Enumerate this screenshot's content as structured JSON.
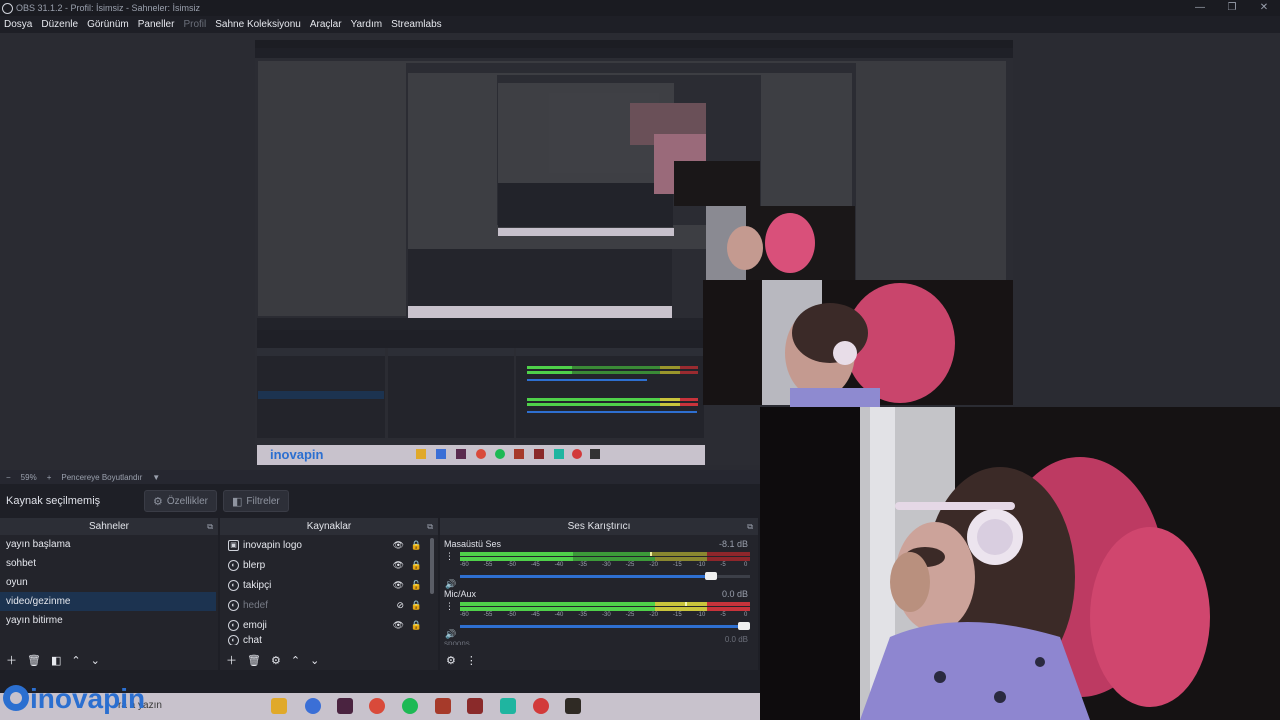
{
  "window": {
    "title": "OBS 31.1.2 - Profil: İsimsiz - Sahneler: İsimsiz",
    "min": "—",
    "max": "❐",
    "close": "✕"
  },
  "menu": {
    "items": [
      "Dosya",
      "Düzenle",
      "Görünüm",
      "Paneller",
      "Profil",
      "Sahne Koleksiyonu",
      "Araçlar",
      "Yardım",
      "Streamlabs"
    ]
  },
  "zoom": {
    "minus": "−",
    "value": "59%",
    "plus": "+",
    "fit": "Pencereye Boyutlandır",
    "caret": "▼"
  },
  "source_toolbar": {
    "status": "Kaynak seçilmemiş",
    "properties": "Özellikler",
    "filters": "Filtreler"
  },
  "scenes": {
    "title": "Sahneler",
    "items": [
      "yayın başlama",
      "sohbet",
      "oyun",
      "video/gezinme",
      "yayın bitirme"
    ],
    "selected": 3
  },
  "sources": {
    "title": "Kaynaklar",
    "items": [
      {
        "label": "inovapin logo",
        "icon": "image-icon"
      },
      {
        "label": "blerp",
        "icon": "browser-icon"
      },
      {
        "label": "takipçi",
        "icon": "browser-icon"
      },
      {
        "label": "hedef",
        "icon": "browser-icon"
      },
      {
        "label": "emoji",
        "icon": "browser-icon"
      },
      {
        "label": "chat",
        "icon": "browser-icon"
      }
    ]
  },
  "mixer": {
    "title": "Ses Karıştırıcı",
    "channels": [
      {
        "name": "Masaüstü Ses",
        "db": "-8.1 dB",
        "volume": 0.88
      },
      {
        "name": "Mic/Aux",
        "db": "0.0 dB",
        "volume": 1.0
      }
    ],
    "next_channel_partial": "spoons",
    "next_db_partial": "0.0 dB",
    "ticks": [
      "-60",
      "-55",
      "-50",
      "-45",
      "-40",
      "-35",
      "-30",
      "-25",
      "-20",
      "-15",
      "-10",
      "-5",
      "0"
    ]
  },
  "taskbar": {
    "search": "ra a yazın",
    "logo_text": "inovapin"
  },
  "colors": {
    "bg": "#1e1f26",
    "meter_green": "#4fd14a",
    "meter_yellow": "#c9c43c",
    "meter_red": "#c8333b",
    "selected": "#1c3350",
    "fader": "#2e6fd0"
  }
}
